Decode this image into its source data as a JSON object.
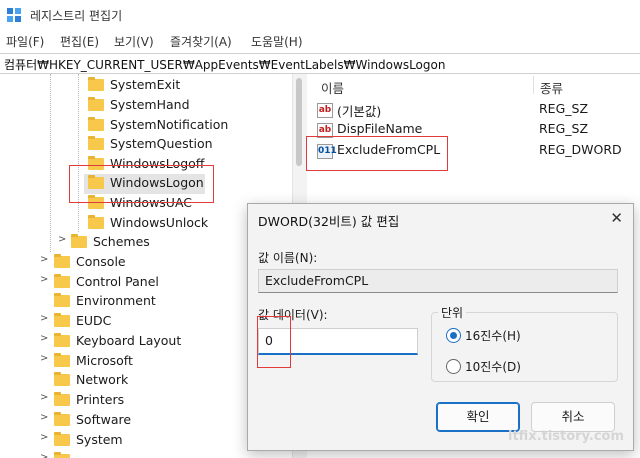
{
  "window": {
    "title": "레지스트리 편집기"
  },
  "menu": [
    "파일(F)",
    "편집(E)",
    "보기(V)",
    "즐겨찾기(A)",
    "도움말(H)"
  ],
  "address": "컴퓨터₩HKEY_CURRENT_USER₩AppEvents₩EventLabels₩WindowsLogon",
  "tree": {
    "items": [
      {
        "label": "SystemExit"
      },
      {
        "label": "SystemHand"
      },
      {
        "label": "SystemNotification"
      },
      {
        "label": "SystemQuestion"
      },
      {
        "label": "WindowsLogoff"
      },
      {
        "label": "WindowsLogon"
      },
      {
        "label": "WindowsUAC"
      },
      {
        "label": "WindowsUnlock"
      },
      {
        "label": "Schemes"
      },
      {
        "label": "Console"
      },
      {
        "label": "Control Panel"
      },
      {
        "label": "Environment"
      },
      {
        "label": "EUDC"
      },
      {
        "label": "Keyboard Layout"
      },
      {
        "label": "Microsoft"
      },
      {
        "label": "Network"
      },
      {
        "label": "Printers"
      },
      {
        "label": "Software"
      },
      {
        "label": "System"
      }
    ],
    "selected": "WindowsLogon"
  },
  "list": {
    "headers": {
      "name": "이름",
      "type": "종류"
    },
    "rows": [
      {
        "icon": "string-value-icon",
        "name": "(기본값)",
        "type": "REG_SZ"
      },
      {
        "icon": "string-value-icon",
        "name": "DispFileName",
        "type": "REG_SZ"
      },
      {
        "icon": "binary-value-icon",
        "name": "ExcludeFromCPL",
        "type": "REG_DWORD"
      }
    ]
  },
  "dialog": {
    "title": "DWORD(32비트) 값 편집",
    "name_label": "값 이름(N):",
    "name_value": "ExcludeFromCPL",
    "data_label": "값 데이터(V):",
    "data_value": "0",
    "base_label": "단위",
    "base_options": [
      "16진수(H)",
      "10진수(D)"
    ],
    "base_selected": "16진수(H)",
    "ok_label": "확인",
    "cancel_label": "취소"
  },
  "watermark": "itfix.tistory.com",
  "colors": {
    "accent": "#1a6fc7",
    "highlight": "#e23a3a",
    "folder": "#f7c84a"
  }
}
